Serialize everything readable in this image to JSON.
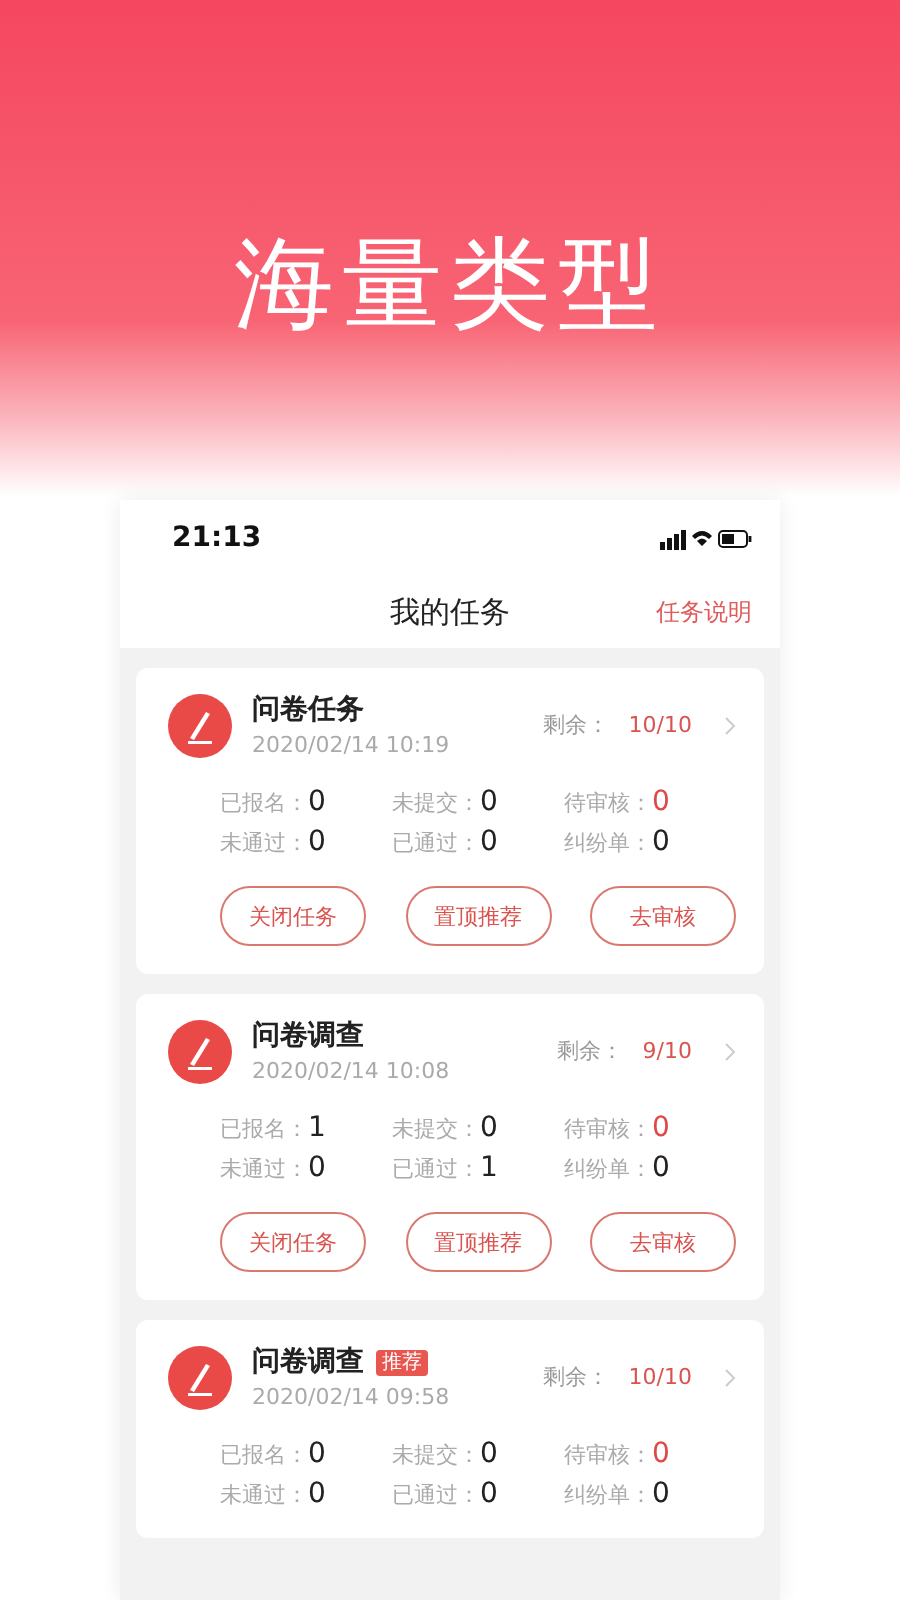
{
  "headline": "海量类型",
  "status_bar": {
    "time": "21:13"
  },
  "nav": {
    "title": "我的任务",
    "action": "任务说明"
  },
  "tasks": [
    {
      "title": "问卷任务",
      "date": "2020/02/14 10:19",
      "remaining_label": "剩余：",
      "remaining": "10/10",
      "stats": [
        {
          "label": "已报名：",
          "value": "0",
          "alert": false
        },
        {
          "label": "未提交：",
          "value": "0",
          "alert": false
        },
        {
          "label": "待审核：",
          "value": "0",
          "alert": true
        },
        {
          "label": "未通过：",
          "value": "0",
          "alert": false
        },
        {
          "label": "已通过：",
          "value": "0",
          "alert": false
        },
        {
          "label": "纠纷单：",
          "value": "0",
          "alert": false
        }
      ],
      "buttons": [
        "关闭任务",
        "置顶推荐",
        "去审核"
      ]
    },
    {
      "title": "问卷调查",
      "date": "2020/02/14 10:08",
      "remaining_label": "剩余：",
      "remaining": "9/10",
      "stats": [
        {
          "label": "已报名：",
          "value": "1",
          "alert": false
        },
        {
          "label": "未提交：",
          "value": "0",
          "alert": false
        },
        {
          "label": "待审核：",
          "value": "0",
          "alert": true
        },
        {
          "label": "未通过：",
          "value": "0",
          "alert": false
        },
        {
          "label": "已通过：",
          "value": "1",
          "alert": false
        },
        {
          "label": "纠纷单：",
          "value": "0",
          "alert": false
        }
      ],
      "buttons": [
        "关闭任务",
        "置顶推荐",
        "去审核"
      ]
    },
    {
      "title": "问卷调查",
      "badge": "推荐",
      "date": "2020/02/14 09:58",
      "remaining_label": "剩余：",
      "remaining": "10/10",
      "stats": [
        {
          "label": "已报名：",
          "value": "0",
          "alert": false
        },
        {
          "label": "未提交：",
          "value": "0",
          "alert": false
        },
        {
          "label": "待审核：",
          "value": "0",
          "alert": true
        },
        {
          "label": "未通过：",
          "value": "0",
          "alert": false
        },
        {
          "label": "已通过：",
          "value": "0",
          "alert": false
        },
        {
          "label": "纠纷单：",
          "value": "0",
          "alert": false
        }
      ]
    }
  ]
}
